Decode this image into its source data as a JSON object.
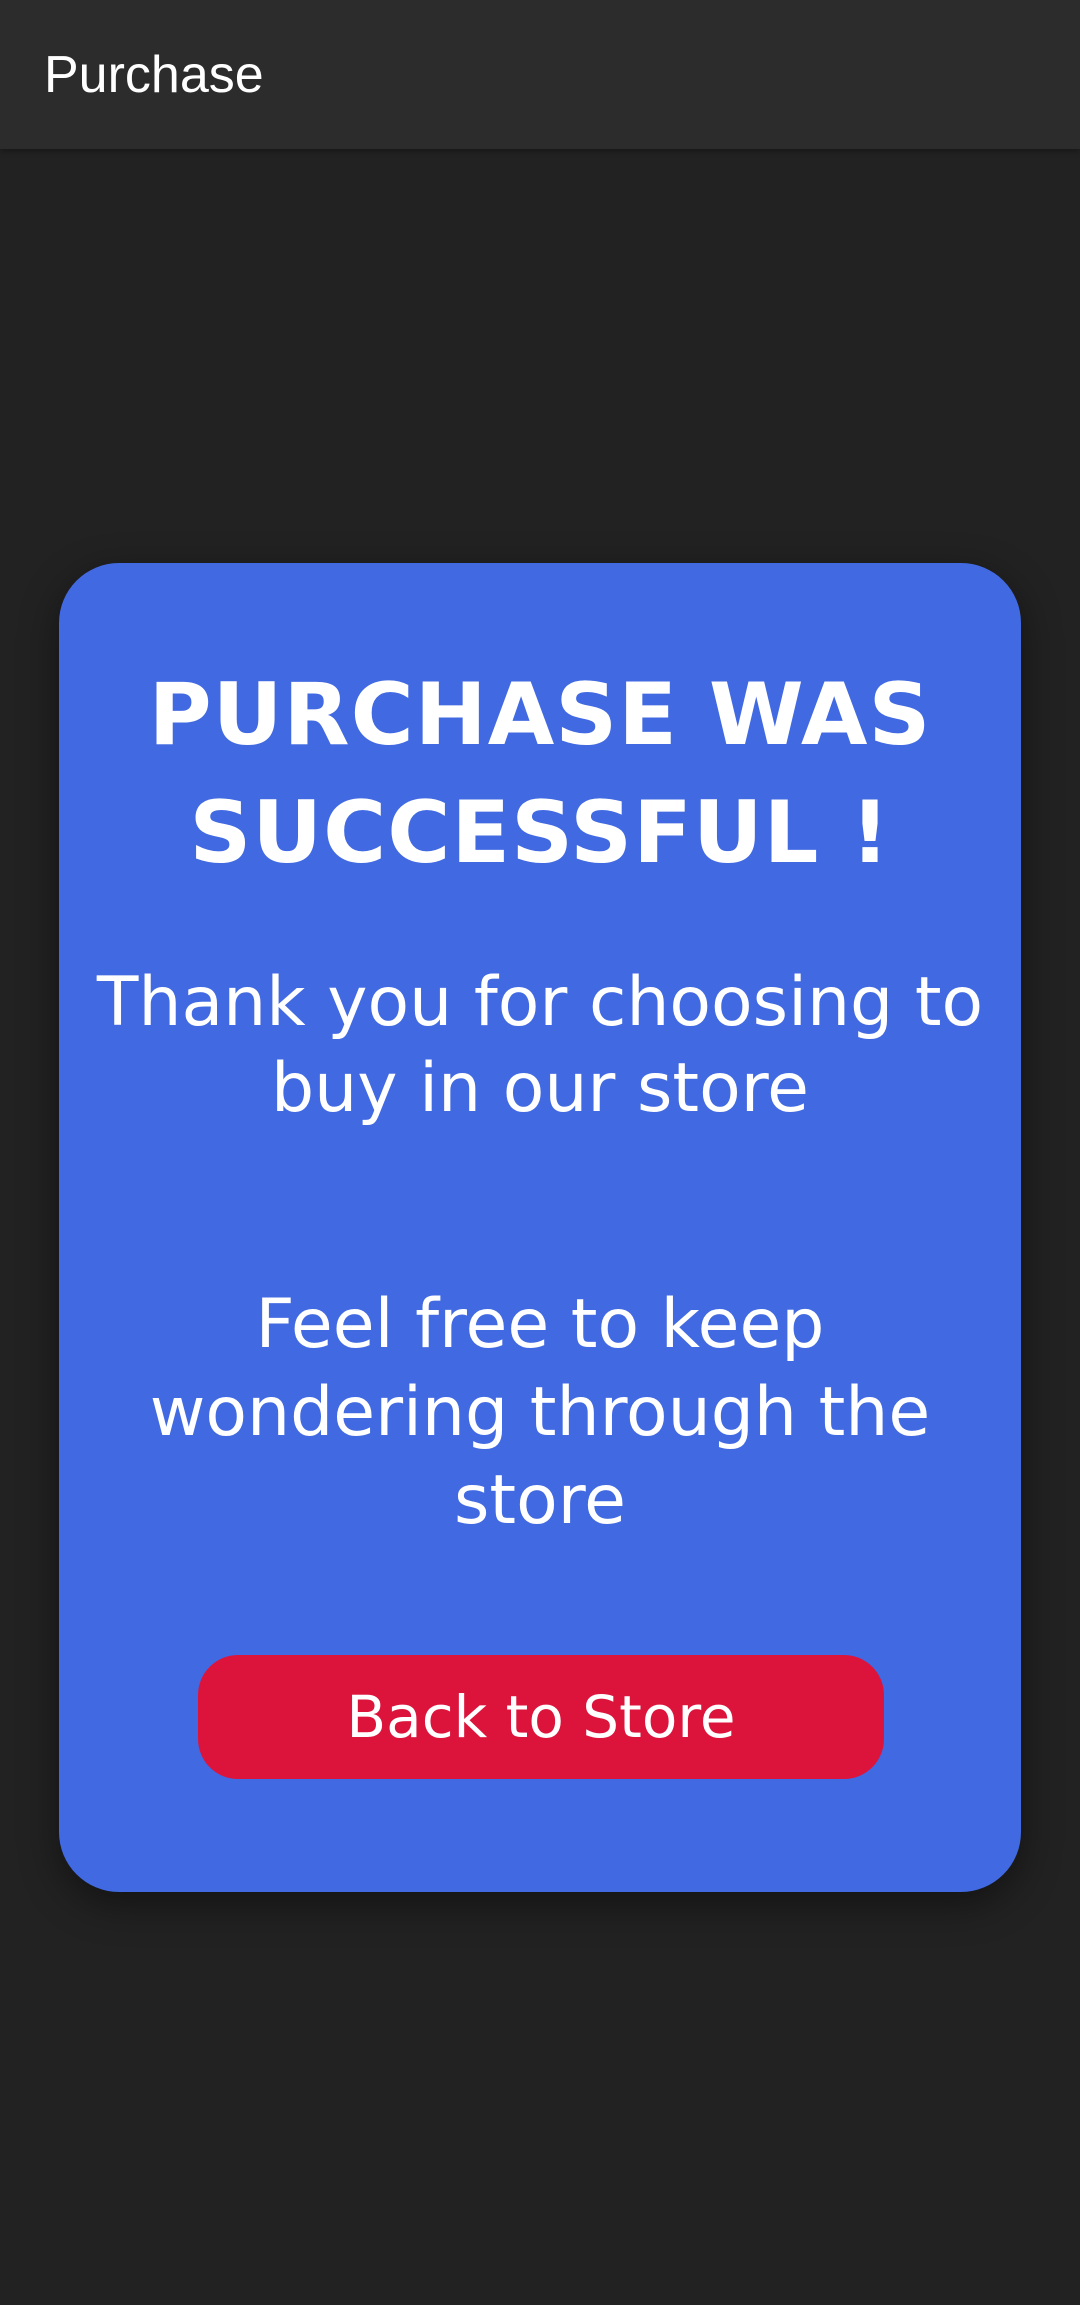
{
  "app_bar": {
    "title": "Purchase"
  },
  "card": {
    "headline": "PURCHASE WAS SUCCESSFUL !",
    "thanks_message": "Thank you for choosing to buy in our store",
    "browse_message": "Feel free to keep wondering through the store",
    "back_button_label": "Back to Store"
  },
  "colors": {
    "background": "#222222",
    "app_bar": "#2c2c2c",
    "card": "#4169e1",
    "button": "#dc143c",
    "text": "#ffffff"
  }
}
